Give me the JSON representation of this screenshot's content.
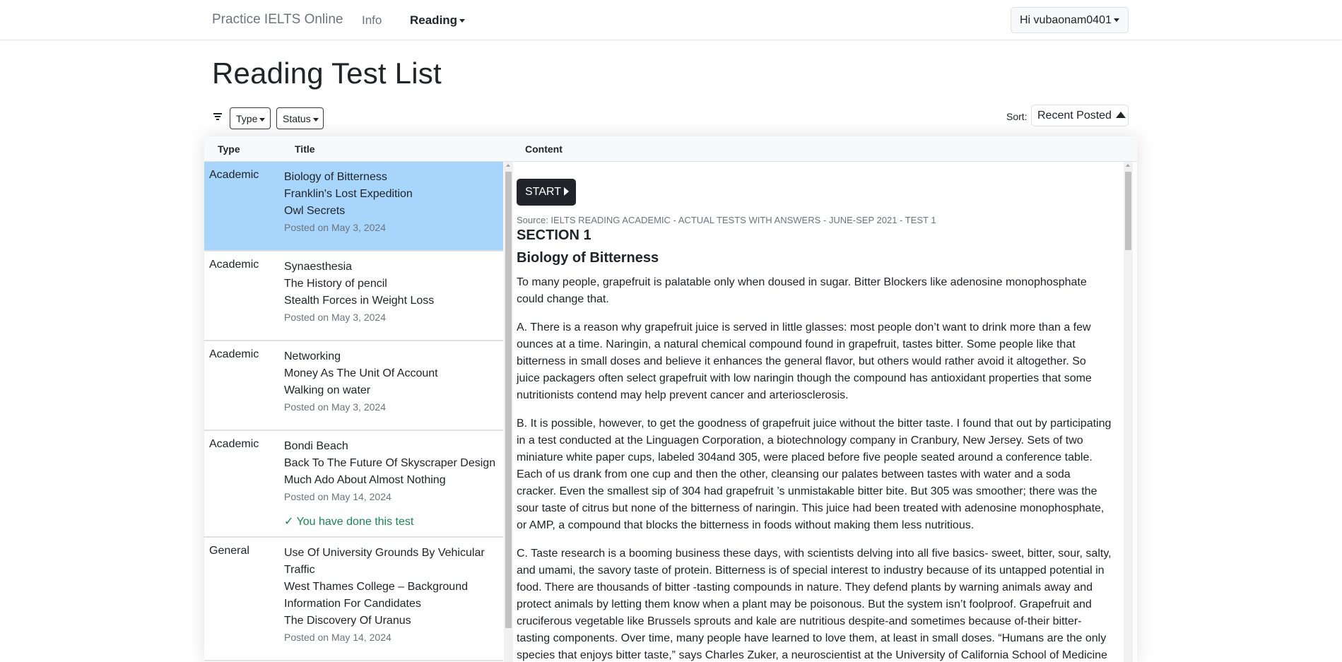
{
  "nav": {
    "brand": "Practice IELTS Online",
    "info": "Info",
    "reading": "Reading",
    "user": "Hi vubaonam0401"
  },
  "page": {
    "title": "Reading Test List"
  },
  "filters": {
    "type": "Type",
    "status": "Status"
  },
  "sort": {
    "label": "Sort:",
    "value": "Recent Posted"
  },
  "table": {
    "col_type": "Type",
    "col_title": "Title",
    "col_content": "Content"
  },
  "tests": [
    {
      "type": "Academic",
      "titles": [
        "Biology of Bitterness",
        "Franklin's Lost Expedition",
        "Owl Secrets"
      ],
      "date": "Posted on May 3, 2024",
      "done": ""
    },
    {
      "type": "Academic",
      "titles": [
        "Synaesthesia",
        "The History of pencil",
        "Stealth Forces in Weight Loss"
      ],
      "date": "Posted on May 3, 2024",
      "done": ""
    },
    {
      "type": "Academic",
      "titles": [
        "Networking",
        "Money As The Unit Of Account",
        "Walking on water"
      ],
      "date": "Posted on May 3, 2024",
      "done": ""
    },
    {
      "type": "Academic",
      "titles": [
        "Bondi Beach",
        "Back To The Future Of Skyscraper Design",
        "Much Ado About Almost Nothing"
      ],
      "date": "Posted on May 14, 2024",
      "done": "✓ You have done this test"
    },
    {
      "type": "General",
      "titles": [
        "Use Of University Grounds By Vehicular Traffic",
        "West Thames College – Background Information For Candidates",
        "The Discovery Of Uranus"
      ],
      "date": "Posted on May 14, 2024",
      "done": ""
    }
  ],
  "content": {
    "start": "START",
    "source": "Source: IELTS READING ACADEMIC - ACTUAL TESTS WITH ANSWERS - JUNE-SEP 2021 - TEST 1",
    "section": "SECTION 1",
    "title": "Biology of Bitterness",
    "paragraphs": [
      "To many people, grapefruit is palatable only when doused in sugar. Bitter Blockers like adenosine monophosphate could change that.",
      "A. There is a reason why grapefruit juice is served in little glasses: most people don’t want to drink more than a few ounces at a time. Naringin, a natural chemical compound found in grapefruit, tastes bitter. Some people like that bitterness in small doses and believe it enhances the general flavor, but others would rather avoid it altogether. So juice packagers often select grapefruit with low naringin though the compound has antioxidant properties that some nutritionists contend may help prevent cancer and arteriosclerosis.",
      "B. It is possible, however, to get the goodness of grapefruit juice without the bitter taste. I found that out by participating in a test conducted at the Linguagen Corporation, a biotechnology company in Cranbury, New Jersey. Sets of two miniature white paper cups, labeled 304and 305, were placed before five people seated around a conference table. Each of us drank from one cup and then the other, cleansing our palates between tastes with water and a soda cracker. Even the smallest sip of 304 had grapefruit ’s unmistakable bitter bite. But 305 was smoother; there was the sour taste of citrus but none of the bitterness of naringin. This juice had been treated with adenosine monophosphate, or AMP, a compound that blocks the bitterness in foods without making them less nutritious.",
      "C. Taste research is a booming business these days, with scientists delving into all five basics- sweet, bitter, sour, salty, and umami, the savory taste of protein. Bitterness is of special interest to industry because of its untapped potential in food. There are thousands of bitter -tasting compounds in nature. They defend plants by warning animals away and protect animals by letting them know when a plant may be poisonous. But the system isn’t foolproof. Grapefruit and cruciferous vegetable like Brussels sprouts and kale are nutritious despite-and sometimes because of-their bitter-tasting components. Over time, many people have learned to love them, at least in small doses. “Humans are the only species that enjoys bitter taste,” says Charles Zuker, a neuroscientist at the University of California School of Medicine"
    ]
  },
  "colors": {
    "selected_row": "#a8d5fb",
    "done_text": "#198754",
    "start_button": "#212529"
  }
}
